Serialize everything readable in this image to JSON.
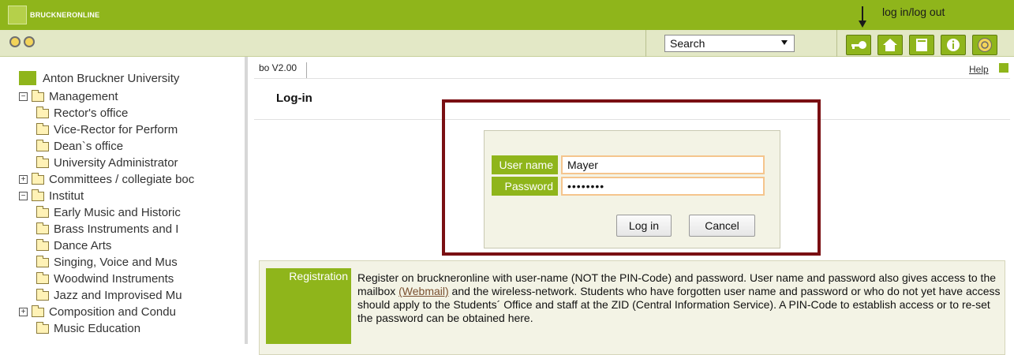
{
  "brand": {
    "name": "BRUCKNERONLINE",
    "color": "#8fb51b"
  },
  "annotation": {
    "text": "log in/log out",
    "arrow": "arrow-down"
  },
  "toolbar": {
    "search_value": "Search",
    "nav_icons": [
      "key-icon",
      "home-icon",
      "book-icon",
      "info-icon",
      "language-icon"
    ]
  },
  "sidebar": {
    "root": "Anton Bruckner University",
    "items": [
      {
        "label": "Management",
        "expander": "⊟",
        "level": 0
      },
      {
        "label": "Rector's office",
        "level": 1
      },
      {
        "label": "Vice-Rector for Perform",
        "level": 1
      },
      {
        "label": "Dean`s office",
        "level": 1
      },
      {
        "label": "University Administrator",
        "level": 1
      },
      {
        "label": "Committees / collegiate boc",
        "expander": "⊞",
        "level": 0
      },
      {
        "label": "Institut",
        "expander": "⊟",
        "level": 0
      },
      {
        "label": "Early Music and Historic",
        "level": 1
      },
      {
        "label": "Brass Instruments and I",
        "level": 1
      },
      {
        "label": "Dance Arts",
        "level": 1
      },
      {
        "label": "Singing, Voice and Mus",
        "level": 1
      },
      {
        "label": "Woodwind Instruments",
        "level": 1
      },
      {
        "label": "Jazz and Improvised Mu",
        "level": 1
      },
      {
        "label": "Composition and Condu",
        "expander": "⊞",
        "level": 1
      },
      {
        "label": "Music Education",
        "level": 1
      }
    ]
  },
  "main": {
    "version": "bo V2.00",
    "help": "Help",
    "login_title": "Log-in",
    "form": {
      "username_label": "User name",
      "username_value": "Mayer",
      "password_label": "Password",
      "password_value": "••••••••",
      "login_button": "Log in",
      "cancel_button": "Cancel"
    },
    "registration": {
      "label": "Registration",
      "text_before_link": "Register on bruckneronline with user-name (NOT the PIN-Code) and password. User name and password also gives access to the mailbox ",
      "link": "(Webmail)",
      "text_after_link": " and the wireless-network. Students who have forgotten user name and password or who do not yet have access should apply to the Students´ Office and staff at the ZID (Central Information Service). A PIN-Code to establish access or to re-set the password can be obtained here."
    }
  }
}
